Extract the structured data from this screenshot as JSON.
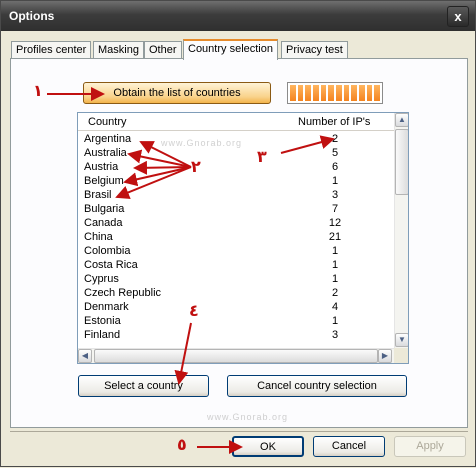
{
  "window": {
    "title": "Options",
    "close_glyph": "x"
  },
  "tabs": [
    "Profiles center",
    "Masking",
    "Other",
    "Country selection",
    "Privacy test"
  ],
  "active_tab": "Country selection",
  "obtain_button": "Obtain the list of countries",
  "progress_segments": 12,
  "list": {
    "columns": [
      "Country",
      "Number of IP's"
    ],
    "rows": [
      [
        "Argentina",
        "2"
      ],
      [
        "Australia",
        "5"
      ],
      [
        "Austria",
        "6"
      ],
      [
        "Belgium",
        "1"
      ],
      [
        "Brasil",
        "3"
      ],
      [
        "Bulgaria",
        "7"
      ],
      [
        "Canada",
        "12"
      ],
      [
        "China",
        "21"
      ],
      [
        "Colombia",
        "1"
      ],
      [
        "Costa Rica",
        "1"
      ],
      [
        "Cyprus",
        "1"
      ],
      [
        "Czech Republic",
        "2"
      ],
      [
        "Denmark",
        "4"
      ],
      [
        "Estonia",
        "1"
      ],
      [
        "Finland",
        "3"
      ]
    ]
  },
  "select_button": "Select a country",
  "cancel_selection_button": "Cancel country selection",
  "footer": {
    "ok": "OK",
    "cancel": "Cancel",
    "apply": "Apply"
  },
  "watermark": "www.Gnorab.org",
  "annotations": {
    "n1": "١",
    "n2": "٢",
    "n3": "٣",
    "n4": "٤",
    "n5": "٥"
  },
  "colors": {
    "annotation": "#c01010",
    "tab_accent": "#e68b2c",
    "progress": "#f4831f"
  }
}
